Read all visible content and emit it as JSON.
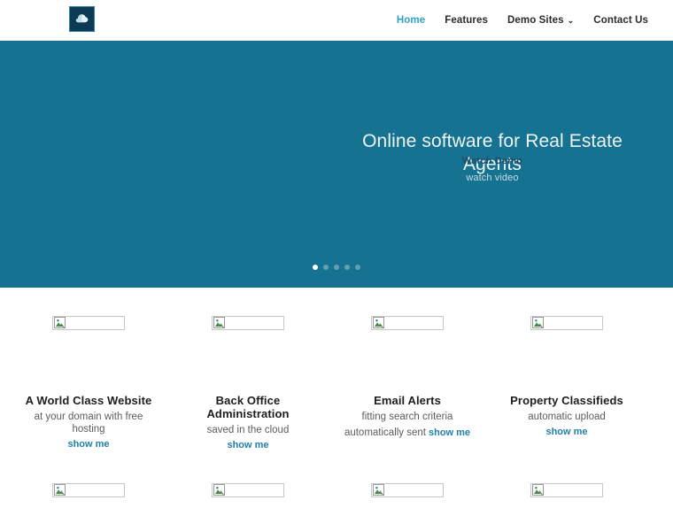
{
  "header": {
    "logo_icon": "cloud-icon",
    "logo_bg": "#0d3b56",
    "nav": [
      {
        "label": "Home",
        "active": true
      },
      {
        "label": "Features",
        "active": false
      },
      {
        "label": "Demo Sites",
        "active": false,
        "caret": "⌄"
      },
      {
        "label": "Contact Us",
        "active": false
      }
    ]
  },
  "hero": {
    "background_color": "#157291",
    "title": "Online software for Real Estate Agents",
    "subtitle": "Watch Demo",
    "note": "watch video",
    "slider": {
      "total": 5,
      "active_index": 0
    }
  },
  "features": {
    "link_color": "#2080a8",
    "row1": [
      {
        "image_alt_icon": "broken-image-icon",
        "title": "A World Class Website",
        "desc": "at your domain with free hosting",
        "link": "show me",
        "inline": false
      },
      {
        "image_alt_icon": "broken-image-icon",
        "title": "Back Office Administration",
        "desc": "saved in the cloud",
        "link": "show me",
        "inline": false
      },
      {
        "image_alt_icon": "broken-image-icon",
        "title": "Email Alerts",
        "desc": "fitting search criteria",
        "desc2": "automatically sent",
        "link": "show me",
        "inline": true
      },
      {
        "image_alt_icon": "broken-image-icon",
        "title": "Property Classifieds",
        "desc": "automatic upload",
        "link": "show me",
        "inline": false
      }
    ],
    "row2": [
      {
        "image_alt_icon": "broken-image-icon"
      },
      {
        "image_alt_icon": "broken-image-icon"
      },
      {
        "image_alt_icon": "broken-image-icon"
      },
      {
        "image_alt_icon": "broken-image-icon"
      }
    ]
  }
}
